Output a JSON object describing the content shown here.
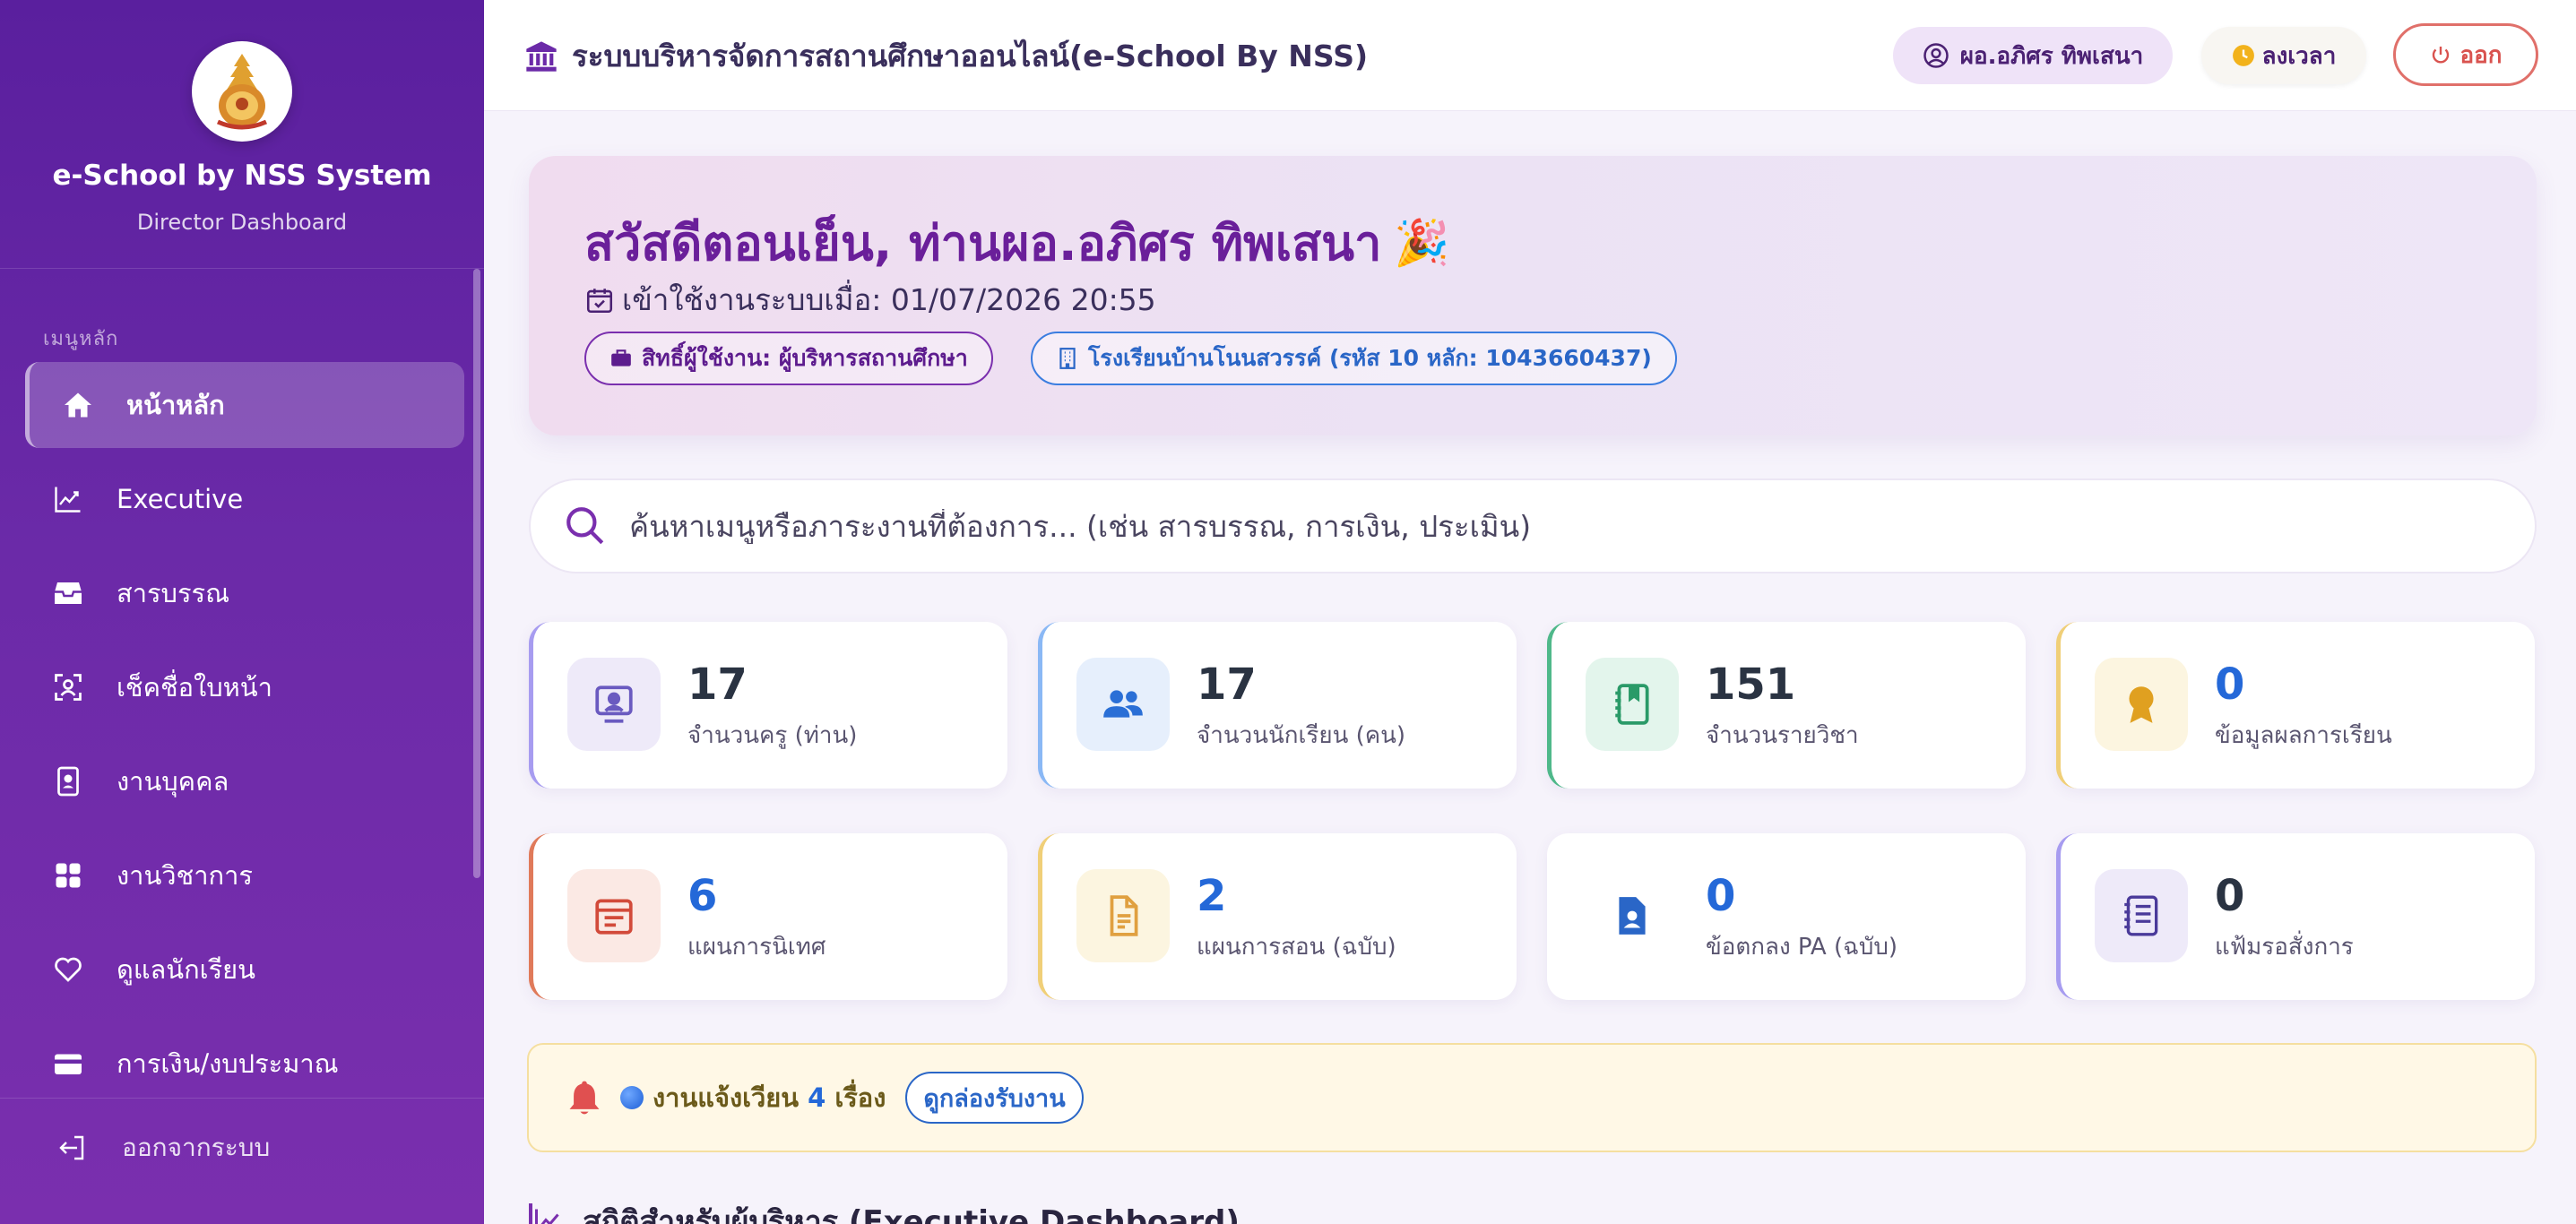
{
  "sidebar": {
    "brand_title": "e-School by NSS System",
    "brand_subtitle": "Director Dashboard",
    "section_label": "เมนูหลัก",
    "items": [
      {
        "label": "หน้าหลัก",
        "icon": "home-icon",
        "active": true
      },
      {
        "label": "Executive",
        "icon": "chart-line-icon"
      },
      {
        "label": "สารบรรณ",
        "icon": "inbox-icon"
      },
      {
        "label": "เช็คชื่อใบหน้า",
        "icon": "face-scan-icon"
      },
      {
        "label": "งานบุคคล",
        "icon": "id-badge-icon"
      },
      {
        "label": "งานวิชาการ",
        "icon": "grid-icon"
      },
      {
        "label": "ดูแลนักเรียน",
        "icon": "heart-icon"
      },
      {
        "label": "การเงิน/งบประมาณ",
        "icon": "wallet-icon"
      }
    ],
    "logout_label": "ออกจากระบบ"
  },
  "topbar": {
    "title": "ระบบบริหารจัดการสถานศึกษาออนไลน์(e-School By NSS)",
    "user_name": "ผอ.อภิศร ทิพเสนา",
    "clock_label": "ลงเวลา",
    "exit_label": "ออก"
  },
  "welcome": {
    "greeting": "สวัสดีตอนเย็น, ท่านผอ.อภิศร ทิพเสนา",
    "emoji": "🎉",
    "login_time": "เข้าใช้งานระบบเมื่อ: 01/07/2026 20:55",
    "role_pill": "สิทธิ์ผู้ใช้งาน: ผู้บริหารสถานศึกษา",
    "school_pill": "โรงเรียนบ้านโนนสวรรค์ (รหัส 10 หลัก: 1043660437)"
  },
  "search": {
    "placeholder": "ค้นหาเมนูหรือภาระงานที่ต้องการ... (เช่น สารบรรณ, การเงิน, ประเมิน)"
  },
  "stats": [
    {
      "value": "17",
      "label": "จำนวนครู (ท่าน)",
      "accent": "#a79cf0",
      "icon_bg": "#eeeaf9",
      "icon_color": "#6a5ac0",
      "num_color": "#2a3342"
    },
    {
      "value": "17",
      "label": "จำนวนนักเรียน (คน)",
      "accent": "#8ab8f5",
      "icon_bg": "#e6effc",
      "icon_color": "#2a6fd6",
      "num_color": "#2a3342"
    },
    {
      "value": "151",
      "label": "จำนวนรายวิชา",
      "accent": "#4fb88a",
      "icon_bg": "#e3f5ec",
      "icon_color": "#2a9a68",
      "num_color": "#2a3342"
    },
    {
      "value": "0",
      "label": "ข้อมูลผลการเรียน",
      "accent": "#f0cf78",
      "icon_bg": "#fcf5e0",
      "icon_color": "#e0a020",
      "num_color": "#2468d8"
    },
    {
      "value": "6",
      "label": "แผนการนิเทศ",
      "accent": "#e07a5a",
      "icon_bg": "#fbe9e4",
      "icon_color": "#d24a3a",
      "num_color": "#2468d8"
    },
    {
      "value": "2",
      "label": "แผนการสอน (ฉบับ)",
      "accent": "#f0cf78",
      "icon_bg": "#fcf5e0",
      "icon_color": "#e0a040",
      "num_color": "#2468d8"
    },
    {
      "value": "0",
      "label": "ข้อตกลง PA (ฉบับ)",
      "accent": "#ffffff",
      "icon_bg": "#ffffff",
      "icon_color": "#2a66c7",
      "num_color": "#2468d8"
    },
    {
      "value": "0",
      "label": "แฟ้มรอสั่งการ",
      "accent": "#a79cf0",
      "icon_bg": "#eeeaf9",
      "icon_color": "#4a3a9a",
      "num_color": "#2a3342"
    }
  ],
  "notice": {
    "text": "งานแจ้งเวียน",
    "count": "4",
    "suffix": "เรื่อง",
    "button": "ดูกล่องรับงาน"
  },
  "section": {
    "title": "สถิติสำหรับผู้บริหาร (Executive Dashboard)"
  }
}
